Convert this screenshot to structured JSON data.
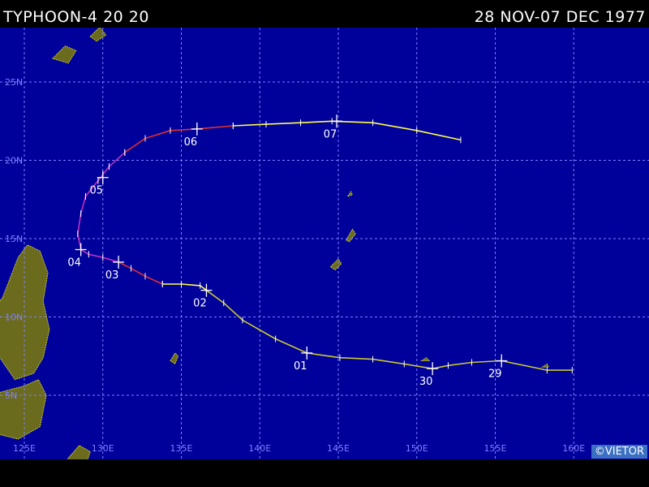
{
  "header": {
    "title": "TYPHOON-4 20 20",
    "dates": "28 NOV-07 DEC 1977"
  },
  "copyright": "©VIETOR",
  "map": {
    "ocean_color": "#00009a",
    "land_color": "#6b6b1e",
    "land_outline": "#c8c832",
    "grid_color": "#7f7fff",
    "lat_labels": [
      {
        "lat": 25,
        "text": "25N"
      },
      {
        "lat": 20,
        "text": "20N"
      },
      {
        "lat": 15,
        "text": "15N"
      },
      {
        "lat": 10,
        "text": "10N"
      },
      {
        "lat": 5,
        "text": "5N"
      }
    ],
    "lon_labels": [
      {
        "lon": 125,
        "text": "125E"
      },
      {
        "lon": 130,
        "text": "130E"
      },
      {
        "lon": 135,
        "text": "135E"
      },
      {
        "lon": 140,
        "text": "140E"
      },
      {
        "lon": 145,
        "text": "145E"
      },
      {
        "lon": 150,
        "text": "150E"
      },
      {
        "lon": 155,
        "text": "155E"
      },
      {
        "lon": 160,
        "text": "160E"
      }
    ]
  },
  "track": {
    "colors": {
      "depression": "#c8c832",
      "storm": "#ffff4a",
      "typhoon_1": "#e03030",
      "typhoon_2": "#c030c0",
      "label": "#ffffff"
    },
    "segments": [
      {
        "category": "depression",
        "points": [
          [
            159.9,
            6.6
          ],
          [
            158.3,
            6.6
          ],
          [
            155.4,
            7.2
          ],
          [
            153.5,
            7.1
          ],
          [
            152.0,
            6.9
          ],
          [
            151.0,
            6.7
          ],
          [
            149.2,
            7.0
          ],
          [
            147.2,
            7.3
          ],
          [
            145.1,
            7.4
          ],
          [
            143.0,
            7.7
          ],
          [
            141.0,
            8.6
          ],
          [
            138.9,
            9.8
          ],
          [
            137.7,
            10.9
          ],
          [
            136.6,
            11.7
          ]
        ]
      },
      {
        "category": "storm",
        "points": [
          [
            136.6,
            11.7
          ],
          [
            136.2,
            12.0
          ],
          [
            135.0,
            12.1
          ],
          [
            133.8,
            12.1
          ]
        ]
      },
      {
        "category": "typhoon_1",
        "points": [
          [
            133.8,
            12.1
          ],
          [
            132.7,
            12.6
          ],
          [
            131.8,
            13.1
          ],
          [
            131.0,
            13.5
          ]
        ]
      },
      {
        "category": "typhoon_2",
        "points": [
          [
            131.0,
            13.5
          ],
          [
            130.0,
            13.8
          ],
          [
            129.1,
            14.0
          ],
          [
            128.6,
            14.3
          ],
          [
            128.4,
            15.3
          ],
          [
            128.6,
            16.6
          ],
          [
            128.9,
            17.7
          ],
          [
            129.7,
            18.7
          ],
          [
            130.4,
            19.6
          ],
          [
            131.4,
            20.5
          ]
        ]
      },
      {
        "category": "typhoon_1",
        "points": [
          [
            131.4,
            20.5
          ],
          [
            132.7,
            21.4
          ],
          [
            134.3,
            21.9
          ],
          [
            136.0,
            22.0
          ],
          [
            138.3,
            22.2
          ]
        ]
      },
      {
        "category": "storm",
        "points": [
          [
            138.3,
            22.2
          ],
          [
            140.4,
            22.3
          ],
          [
            142.6,
            22.4
          ],
          [
            144.6,
            22.5
          ],
          [
            147.2,
            22.4
          ],
          [
            150.0,
            21.9
          ],
          [
            152.8,
            21.3
          ]
        ]
      }
    ],
    "day_marks": [
      {
        "text": "29",
        "lon": 155.4,
        "lat": 7.2
      },
      {
        "text": "30",
        "lon": 151.0,
        "lat": 6.7
      },
      {
        "text": "01",
        "lon": 143.0,
        "lat": 7.7
      },
      {
        "text": "02",
        "lon": 136.6,
        "lat": 11.7
      },
      {
        "text": "03",
        "lon": 131.0,
        "lat": 13.5
      },
      {
        "text": "04",
        "lon": 128.6,
        "lat": 14.3
      },
      {
        "text": "05",
        "lon": 130.0,
        "lat": 18.9
      },
      {
        "text": "06",
        "lon": 136.0,
        "lat": 22.0
      },
      {
        "text": "07",
        "lon": 144.9,
        "lat": 22.5
      }
    ]
  },
  "land": [
    {
      "name": "Philippines-main",
      "points": [
        [
          122.5,
          10.0
        ],
        [
          123.6,
          11.2
        ],
        [
          124.6,
          13.8
        ],
        [
          125.2,
          14.6
        ],
        [
          126.0,
          14.2
        ],
        [
          126.5,
          12.8
        ],
        [
          126.2,
          11.0
        ],
        [
          126.6,
          9.2
        ],
        [
          126.2,
          7.4
        ],
        [
          125.6,
          6.4
        ],
        [
          124.4,
          6.0
        ],
        [
          123.3,
          7.6
        ],
        [
          122.5,
          8.6
        ]
      ]
    },
    {
      "name": "Mindanao-south",
      "points": [
        [
          122.5,
          4.6
        ],
        [
          123.5,
          5.2
        ],
        [
          125.0,
          5.6
        ],
        [
          125.9,
          6.0
        ],
        [
          126.4,
          5.0
        ],
        [
          126.0,
          3.0
        ],
        [
          124.6,
          2.2
        ],
        [
          123.0,
          2.6
        ],
        [
          122.5,
          3.4
        ]
      ]
    },
    {
      "name": "Halmahera",
      "points": [
        [
          127.0,
          -0.5
        ],
        [
          127.8,
          1.0
        ],
        [
          128.5,
          1.8
        ],
        [
          129.2,
          1.4
        ],
        [
          128.8,
          0.2
        ],
        [
          128.0,
          -0.5
        ]
      ]
    },
    {
      "name": "Palau",
      "points": [
        [
          134.3,
          7.2
        ],
        [
          134.6,
          7.7
        ],
        [
          134.8,
          7.5
        ],
        [
          134.6,
          7.0
        ]
      ]
    },
    {
      "name": "Ryukyu-a",
      "points": [
        [
          126.8,
          26.5
        ],
        [
          127.6,
          27.3
        ],
        [
          128.3,
          27.0
        ],
        [
          127.8,
          26.2
        ]
      ]
    },
    {
      "name": "Ryukyu-b",
      "points": [
        [
          129.2,
          27.9
        ],
        [
          129.8,
          28.5
        ],
        [
          130.2,
          28.0
        ],
        [
          129.6,
          27.6
        ]
      ]
    },
    {
      "name": "Luzon-north",
      "points": [
        [
          122.5,
          22.0
        ],
        [
          123.2,
          22.6
        ],
        [
          122.9,
          21.4
        ],
        [
          122.5,
          21.2
        ]
      ]
    },
    {
      "name": "Guam",
      "points": [
        [
          144.5,
          13.2
        ],
        [
          145.0,
          13.7
        ],
        [
          145.2,
          13.4
        ],
        [
          144.8,
          13.0
        ]
      ]
    },
    {
      "name": "Saipan",
      "points": [
        [
          145.5,
          14.9
        ],
        [
          145.9,
          15.6
        ],
        [
          146.1,
          15.3
        ],
        [
          145.7,
          14.8
        ]
      ]
    },
    {
      "name": "Pagan",
      "points": [
        [
          145.6,
          17.7
        ],
        [
          145.8,
          18.0
        ],
        [
          145.9,
          17.8
        ]
      ]
    },
    {
      "name": "Mortlock",
      "points": [
        [
          150.3,
          7.2
        ],
        [
          150.6,
          7.4
        ],
        [
          150.8,
          7.2
        ]
      ]
    },
    {
      "name": "Pohnpei",
      "points": [
        [
          158.0,
          6.8
        ],
        [
          158.3,
          7.0
        ],
        [
          158.4,
          6.8
        ]
      ]
    }
  ]
}
